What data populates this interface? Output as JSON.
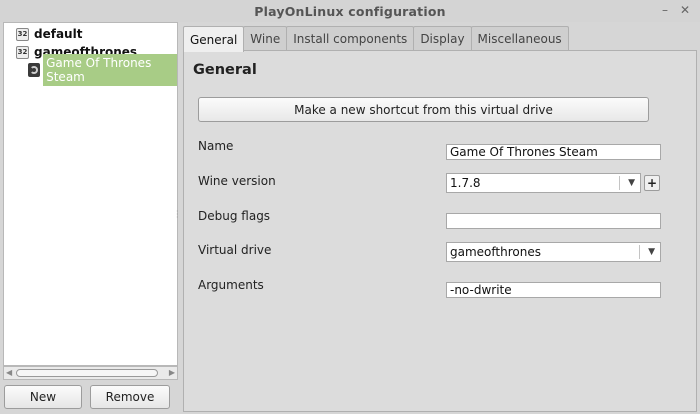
{
  "window": {
    "title": "PlayOnLinux configuration",
    "minimize_glyph": "–",
    "close_glyph": "✕"
  },
  "tree": {
    "items": [
      {
        "label": "default",
        "badge": "32",
        "icon": "arch-32bit-icon"
      },
      {
        "label": "gameofthrones",
        "badge": "32",
        "icon": "arch-32bit-icon"
      },
      {
        "label": "Game Of Thrones Steam",
        "icon": "steam-icon",
        "selected": true
      }
    ]
  },
  "scroll": {
    "left_arrow": "◀",
    "right_arrow": "▶"
  },
  "buttons": {
    "new": "New",
    "remove": "Remove"
  },
  "tabs": [
    "General",
    "Wine",
    "Install components",
    "Display",
    "Miscellaneous"
  ],
  "active_tab": "General",
  "general": {
    "heading": "General",
    "shortcut_button": "Make a new shortcut from this virtual drive",
    "name_label": "Name",
    "name_value": "Game Of Thrones Steam",
    "wine_version_label": "Wine version",
    "wine_version_value": "1.7.8",
    "wine_add_glyph": "+",
    "debug_flags_label": "Debug flags",
    "debug_flags_value": "",
    "virtual_drive_label": "Virtual drive",
    "virtual_drive_value": "gameofthrones",
    "arguments_label": "Arguments",
    "arguments_value": "-no-dwrite",
    "dropdown_glyph": "▼"
  }
}
